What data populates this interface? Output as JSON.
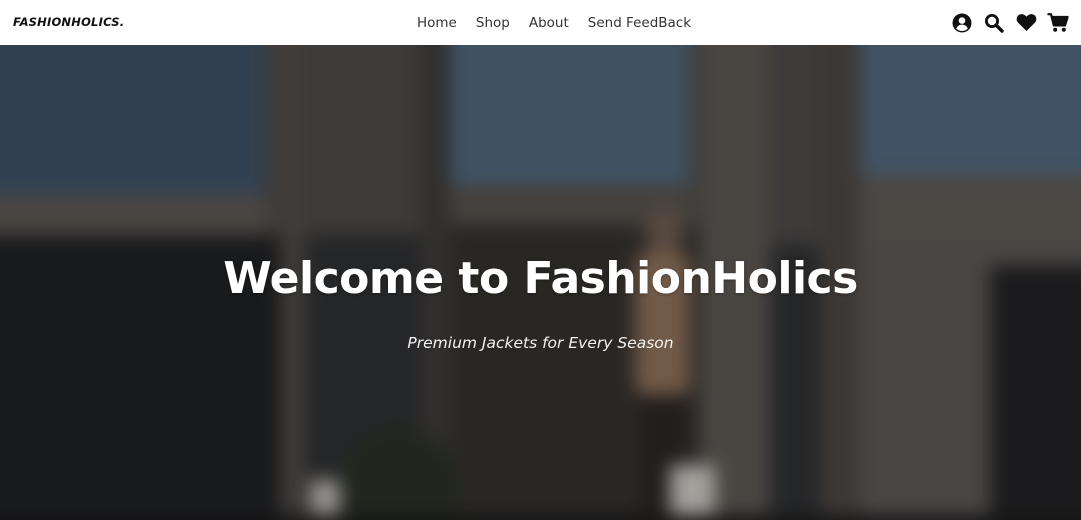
{
  "brand": {
    "name": "FASHIONHOLICS."
  },
  "nav": {
    "links": [
      {
        "label": "Home"
      },
      {
        "label": "Shop"
      },
      {
        "label": "About"
      },
      {
        "label": "Send FeedBack"
      }
    ],
    "icons": [
      {
        "name": "user-icon"
      },
      {
        "name": "search-icon"
      },
      {
        "name": "heart-icon"
      },
      {
        "name": "cart-icon"
      }
    ]
  },
  "hero": {
    "title": "Welcome to FashionHolics",
    "subtitle": "Premium Jackets for Every Season"
  },
  "colors": {
    "navbar_bg": "#ffffff",
    "text_dark": "#111111",
    "hero_text": "#ffffff"
  }
}
